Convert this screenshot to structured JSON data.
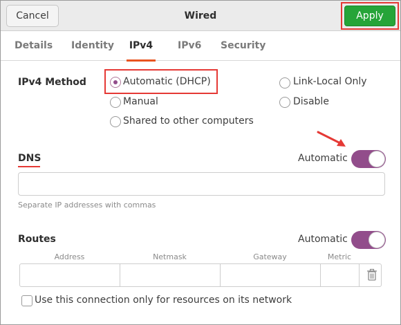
{
  "window": {
    "title": "Wired"
  },
  "header": {
    "cancel_label": "Cancel",
    "apply_label": "Apply"
  },
  "tabs": [
    {
      "label": "Details"
    },
    {
      "label": "Identity"
    },
    {
      "label": "IPv4",
      "active": true
    },
    {
      "label": "IPv6"
    },
    {
      "label": "Security"
    }
  ],
  "ipv4": {
    "method_label": "IPv4 Method",
    "options": [
      {
        "label": "Automatic (DHCP)",
        "checked": true
      },
      {
        "label": "Manual",
        "checked": false
      },
      {
        "label": "Shared to other computers",
        "checked": false
      },
      {
        "label": "Link-Local Only",
        "checked": false
      },
      {
        "label": "Disable",
        "checked": false
      }
    ]
  },
  "dns": {
    "label": "DNS",
    "automatic_label": "Automatic",
    "automatic_on": true,
    "value": "",
    "hint": "Separate IP addresses with commas"
  },
  "routes": {
    "label": "Routes",
    "automatic_label": "Automatic",
    "automatic_on": true,
    "columns": [
      "Address",
      "Netmask",
      "Gateway",
      "Metric"
    ],
    "row": {
      "address": "",
      "netmask": "",
      "gateway": "",
      "metric": ""
    },
    "only_local_label": "Use this connection only for resources on its network",
    "only_local_checked": false
  },
  "colors": {
    "accent": "#924d8b",
    "apply": "#26a438",
    "tab_underline": "#e95420",
    "annotation": "#e53935"
  },
  "icons": {
    "trash": "trash-icon",
    "arrow": "arrow-annotation-icon"
  }
}
